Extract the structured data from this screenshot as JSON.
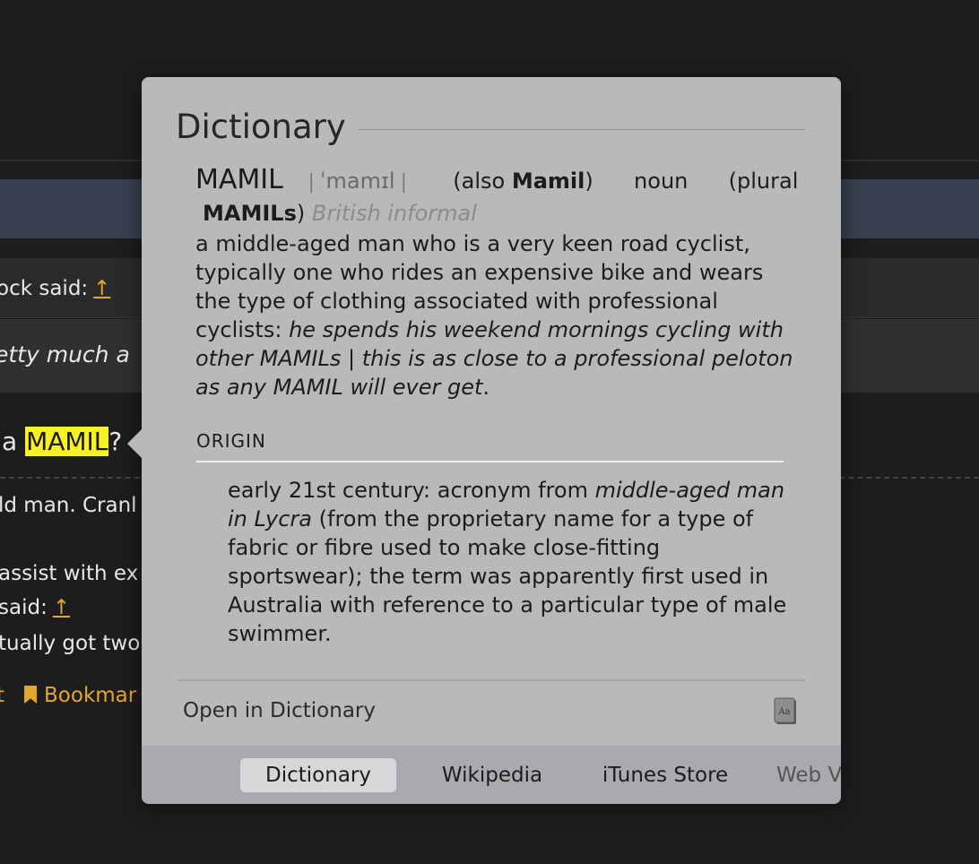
{
  "background": {
    "quote_author": "ock said:",
    "quote_arrow": "↑",
    "quote_text": "etty much a",
    "line_prefix": "a",
    "highlighted_word": "MAMIL",
    "line_suffix": "?",
    "line_old_man": "ld man. Cranl",
    "line_assist": "assist with ex",
    "line_said": "said:",
    "said_arrow": "↑",
    "line_actually": "tually got two",
    "action_t": "t",
    "action_bookmark": "Bookmar"
  },
  "popover": {
    "title": "Dictionary",
    "headword": "MAMIL",
    "sep_left": "|",
    "pronunciation": "ˈmamɪl",
    "sep_right": "|",
    "also_open": "(also ",
    "also_word": "Mamil",
    "also_close": ")",
    "part_of_speech": "noun",
    "plural_open": "(plural",
    "plural_word": "MAMILs",
    "plural_close": ")",
    "register": "British informal",
    "definition_plain": "a middle-aged man who is a very keen road cyclist, typically one who rides an expensive bike and wears the type of clothing associated with professional cyclists: ",
    "definition_examples": "he spends his weekend mornings cycling with other MAMILs | this is as close to a professional peloton as any MAMIL will ever get",
    "definition_end": ".",
    "origin_heading": "ORIGIN",
    "origin_part1": "early 21st century: acronym from ",
    "origin_italic": "middle-aged man in Lycra",
    "origin_part2": " (from the proprietary name for a type of fabric or fibre used to make close-fitting sportswear); the term was apparently first used in Australia with reference to a particular type of male swimmer.",
    "open_link": "Open in Dictionary",
    "book_icon_text": "Aa"
  },
  "tabs": [
    {
      "label": "Dictionary",
      "active": true
    },
    {
      "label": "Wikipedia",
      "active": false
    },
    {
      "label": "iTunes Store",
      "active": false
    },
    {
      "label": "Web V",
      "active": false
    }
  ],
  "colors": {
    "accent": "#e3a72f",
    "highlight": "#f7f126",
    "popover_bg": "#b8b9bb",
    "page_bg": "#1d1d1e"
  }
}
